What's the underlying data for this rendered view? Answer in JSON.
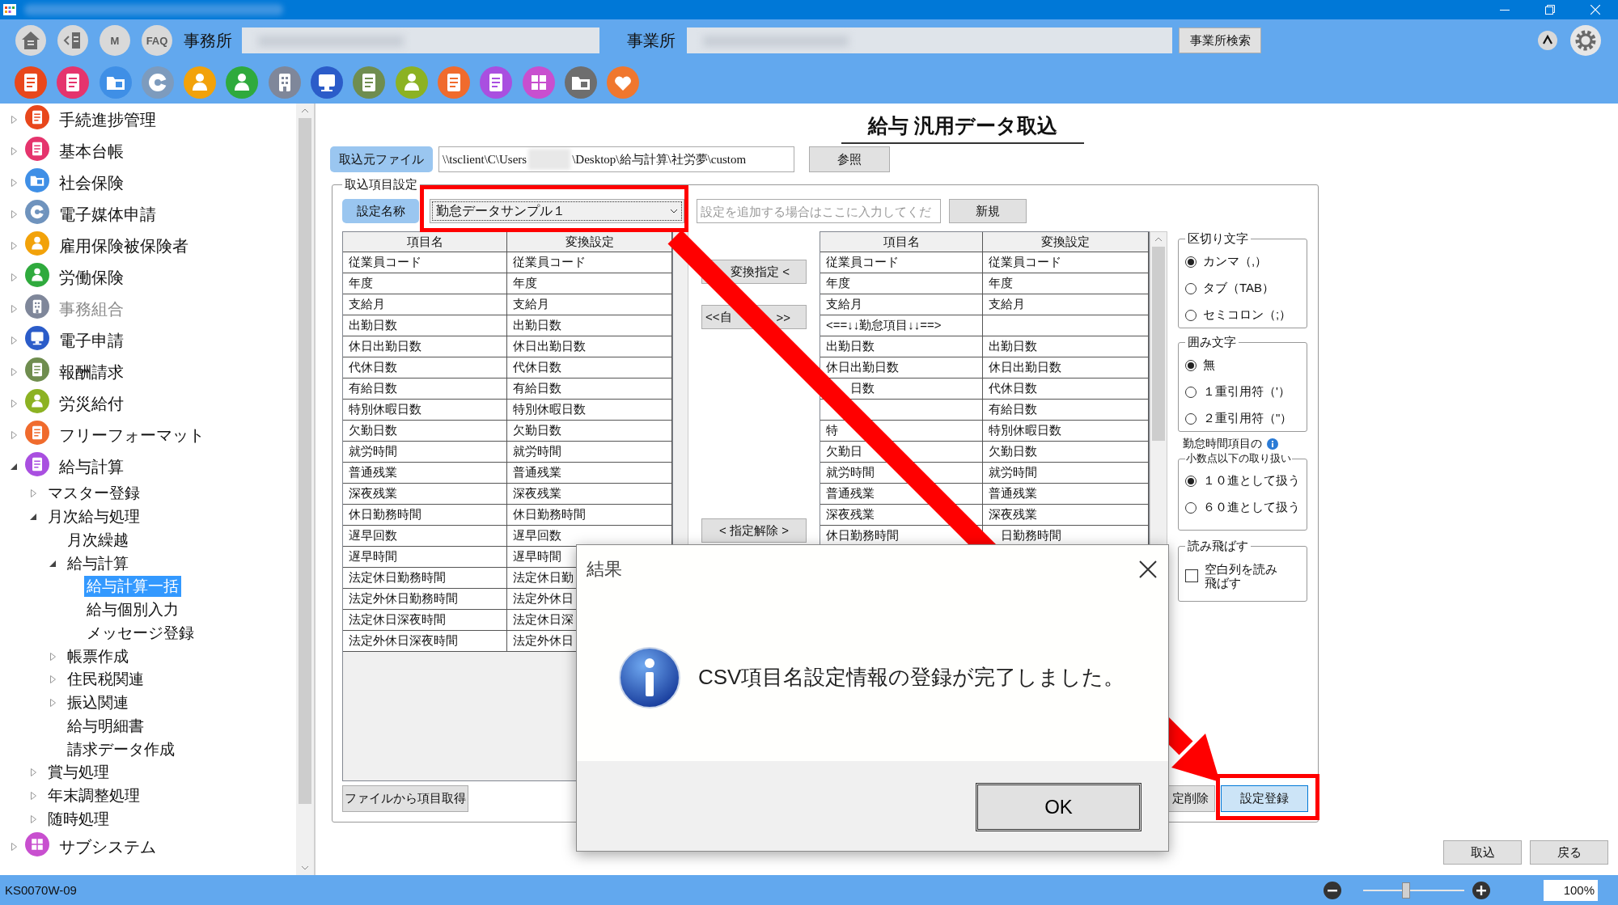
{
  "toolbar": {
    "nav_buttons": [
      {
        "kind": "home"
      },
      {
        "kind": "back"
      },
      {
        "kind": "letter",
        "label": "M"
      },
      {
        "kind": "letter",
        "label": "FAQ"
      }
    ],
    "office_label": "事務所",
    "site_label": "事業所",
    "site_search_button": "事業所検索",
    "app_icons": [
      {
        "color": "#e8471c"
      },
      {
        "color": "#e5346d"
      },
      {
        "color": "#3f8fe6"
      },
      {
        "color": "#7d9bbd"
      },
      {
        "color": "#f2a20a"
      },
      {
        "color": "#2faa3d"
      },
      {
        "color": "#7f879a"
      },
      {
        "color": "#2b5cc9"
      },
      {
        "color": "#6f8d4f"
      },
      {
        "color": "#8cb223"
      },
      {
        "color": "#f06b2d"
      },
      {
        "color": "#a94fe0"
      },
      {
        "color": "#c84fcf"
      },
      {
        "color": "#6e6e6e"
      },
      {
        "color": "#f0772e"
      }
    ]
  },
  "sidebar": {
    "items": [
      {
        "label": "手続進捗管理",
        "color": "#e8471c",
        "expanded": false,
        "selected": false,
        "disabled": false
      },
      {
        "label": "基本台帳",
        "color": "#e5346d",
        "expanded": false,
        "selected": false,
        "disabled": false
      },
      {
        "label": "社会保険",
        "color": "#3f8fe6",
        "expanded": false,
        "selected": false,
        "disabled": false
      },
      {
        "label": "電子媒体申請",
        "color": "#6f93bd",
        "expanded": false,
        "selected": false,
        "disabled": false
      },
      {
        "label": "雇用保険被保険者",
        "color": "#f2a20a",
        "expanded": false,
        "selected": false,
        "disabled": false
      },
      {
        "label": "労働保険",
        "color": "#2faa3d",
        "expanded": false,
        "selected": false,
        "disabled": false
      },
      {
        "label": "事務組合",
        "color": "#7f879a",
        "expanded": false,
        "selected": false,
        "disabled": true
      },
      {
        "label": "電子申請",
        "color": "#2b5cc9",
        "expanded": false,
        "selected": false,
        "disabled": false
      },
      {
        "label": "報酬請求",
        "color": "#6f8d4f",
        "expanded": false,
        "selected": false,
        "disabled": false
      },
      {
        "label": "労災給付",
        "color": "#8cb223",
        "expanded": false,
        "selected": false,
        "disabled": false
      },
      {
        "label": "フリーフォーマット",
        "color": "#f06b2d",
        "expanded": false,
        "selected": false,
        "disabled": false
      },
      {
        "label": "給与計算",
        "color": "#a94fe0",
        "expanded": true,
        "selected": false,
        "disabled": false,
        "children": [
          {
            "label": "マスター登録",
            "expanded": false,
            "selected": false
          },
          {
            "label": "月次給与処理",
            "expanded": true,
            "selected": false,
            "children": [
              {
                "label": "月次繰越",
                "selected": false
              },
              {
                "label": "給与計算",
                "expanded": true,
                "selected": false,
                "children": [
                  {
                    "label": "給与計算一括",
                    "selected": true
                  },
                  {
                    "label": "給与個別入力",
                    "selected": false
                  },
                  {
                    "label": "メッセージ登録",
                    "selected": false
                  }
                ]
              },
              {
                "label": "帳票作成",
                "expanded": false,
                "selected": false
              },
              {
                "label": "住民税関連",
                "expanded": false,
                "selected": false
              },
              {
                "label": "振込関連",
                "expanded": false,
                "selected": false
              },
              {
                "label": "給与明細書",
                "selected": false
              },
              {
                "label": "請求データ作成",
                "selected": false
              }
            ]
          },
          {
            "label": "賞与処理",
            "expanded": false,
            "selected": false
          },
          {
            "label": "年末調整処理",
            "expanded": false,
            "selected": false
          },
          {
            "label": "随時処理",
            "expanded": false,
            "selected": false
          }
        ]
      },
      {
        "label": "サブシステム",
        "color": "#c84fcf",
        "expanded": false,
        "selected": false,
        "disabled": false
      }
    ]
  },
  "page_title": "給与 汎用データ取込",
  "source_file": {
    "button": "取込元ファイル",
    "path_start": "\\\\tsclient\\C\\Users",
    "path_end": "\\Desktop\\給与計算\\社労夢\\custom",
    "browse_button": "参照"
  },
  "import_settings": {
    "legend": "取込項目設定",
    "name_label": "設定名称",
    "name_select": "勤怠データサンプル１",
    "new_name": {
      "placeholder": "設定を追加する場合はここに入力してくだ"
    },
    "new_button": "新規",
    "source_table": {
      "columns": [
        "項目名",
        "変換設定"
      ],
      "rows": [
        {
          "name": "従業員コード",
          "conversion": "従業員コード"
        },
        {
          "name": "年度",
          "conversion": "年度"
        },
        {
          "name": "支給月",
          "conversion": "支給月"
        },
        {
          "name": "出勤日数",
          "conversion": "出勤日数"
        },
        {
          "name": "休日出勤日数",
          "conversion": "休日出勤日数"
        },
        {
          "name": "代休日数",
          "conversion": "代休日数"
        },
        {
          "name": "有給日数",
          "conversion": "有給日数"
        },
        {
          "name": "特別休暇日数",
          "conversion": "特別休暇日数"
        },
        {
          "name": "欠勤日数",
          "conversion": "欠勤日数"
        },
        {
          "name": "就労時間",
          "conversion": "就労時間"
        },
        {
          "name": "普通残業",
          "conversion": "普通残業"
        },
        {
          "name": "深夜残業",
          "conversion": "深夜残業"
        },
        {
          "name": "休日勤務時間",
          "conversion": "休日勤務時間"
        },
        {
          "name": "遅早回数",
          "conversion": "遅早回数"
        },
        {
          "name": "遅早時間",
          "conversion": "遅早時間"
        },
        {
          "name": "法定休日勤務時間",
          "conversion": "法定休日勤"
        },
        {
          "name": "法定外休日勤務時間",
          "conversion": "法定外休日"
        },
        {
          "name": "法定休日深夜時間",
          "conversion": "法定休日深"
        },
        {
          "name": "法定外休日深夜時間",
          "conversion": "法定外休日"
        }
      ]
    },
    "actions": [
      {
        "kind": "plain",
        "label": "変換指定 <"
      },
      {
        "kind": "split",
        "parts": [
          "<<自",
          ">>"
        ]
      },
      {
        "kind": "plain",
        "label": "< 指定解除 >"
      }
    ],
    "target_table": {
      "columns": [
        "項目名",
        "変換設定"
      ],
      "rows": [
        {
          "kind": "plain",
          "name": "従業員コード",
          "conversion": "従業員コード"
        },
        {
          "kind": "plain",
          "name": "年度",
          "conversion": "年度"
        },
        {
          "kind": "plain",
          "name": "支給月",
          "conversion": "支給月"
        },
        {
          "kind": "plain",
          "name": "<==↓↓勤怠項目↓↓==>"
        },
        {
          "kind": "plain",
          "name": "出勤日数",
          "conversion": "出勤日数"
        },
        {
          "kind": "plain",
          "name": "休日出勤日数",
          "conversion": "休日出勤日数"
        },
        {
          "kind": "name_tail",
          "name": "日数",
          "conversion": "代休日数"
        },
        {
          "kind": "plain",
          "conversion": "有給日数"
        },
        {
          "kind": "plain",
          "name": "特",
          "conversion": "特別休暇日数"
        },
        {
          "kind": "plain",
          "name": "欠勤日",
          "conversion": "欠勤日数"
        },
        {
          "kind": "plain",
          "name": "就労時間",
          "conversion": "就労時間"
        },
        {
          "kind": "plain",
          "name": "普通残業",
          "conversion": "普通残業"
        },
        {
          "kind": "plain",
          "name": "深夜残業",
          "conversion": "深夜残業"
        },
        {
          "kind": "conv_tail",
          "name": "休日勤務時間",
          "conversion": "日勤務時間"
        }
      ]
    },
    "get_from_file_button": "ファイルから項目取得",
    "delete_button": "定削除",
    "save_button": "設定登録"
  },
  "options": {
    "delimiter": {
      "legend": "区切り文字",
      "options": [
        {
          "label": "カンマ（,）",
          "selected": true
        },
        {
          "label": "タブ（TAB）",
          "selected": false
        },
        {
          "label": "セミコロン（;）",
          "selected": false
        }
      ]
    },
    "quote": {
      "legend": "囲み文字",
      "options": [
        {
          "label": "無",
          "selected": true
        },
        {
          "label": "１重引用符（'）",
          "selected": false
        },
        {
          "label": "２重引用符（\"）",
          "selected": false
        }
      ]
    },
    "decimal": {
      "note": "勤怠時間項目の",
      "legend": "小数点以下の取り扱い",
      "options": [
        {
          "label": "１０進として扱う",
          "selected": true
        },
        {
          "label": "６０進として扱う",
          "selected": false
        }
      ]
    },
    "skip": {
      "legend": "読み飛ばす",
      "checkbox": {
        "label": "空白列を読み飛ばす",
        "checked": false
      }
    }
  },
  "footer_buttons": [
    "取込",
    "戻る"
  ],
  "dialog": {
    "title": "結果",
    "message": "CSV項目名設定情報の登録が完了しました。",
    "ok": "OK"
  },
  "status_bar": {
    "screen_id": "KS0070W-09",
    "zoom": {
      "level": 0.42
    },
    "zoom_value": "100%"
  }
}
